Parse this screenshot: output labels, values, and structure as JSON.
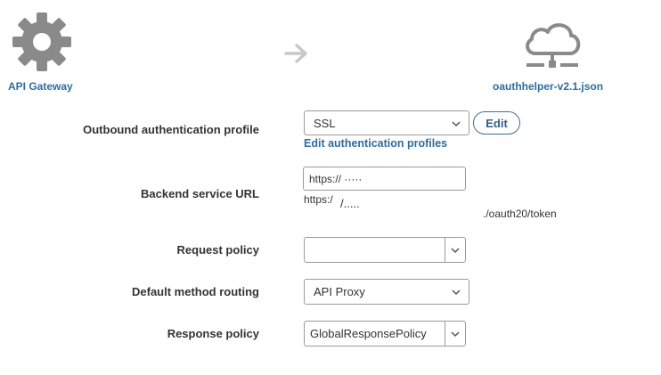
{
  "header": {
    "source_label": "API Gateway",
    "source_icon": "gear-icon",
    "arrow_icon": "arrow-right-icon",
    "target_label": "oauthhelper-v2.1.json",
    "target_icon": "cloud-network-icon"
  },
  "form": {
    "auth_profile": {
      "label": "Outbound authentication profile",
      "value": "SSL",
      "edit_button": "Edit",
      "edit_link": "Edit authentication profiles"
    },
    "backend_url": {
      "label": "Backend service URL",
      "value": "https://  ·····",
      "hint_prefix": "https:/",
      "hint_mid": "/.....",
      "hint_suffix": "./oauth20/token"
    },
    "request_policy": {
      "label": "Request policy",
      "value": ""
    },
    "method_routing": {
      "label": "Default method routing",
      "value": "API Proxy"
    },
    "response_policy": {
      "label": "Response policy",
      "value": "GlobalResponsePolicy"
    }
  },
  "colors": {
    "icon_gray": "#8a8a8a",
    "arrow_gray": "#c8c8c8",
    "link_blue": "#2f6c9e"
  }
}
